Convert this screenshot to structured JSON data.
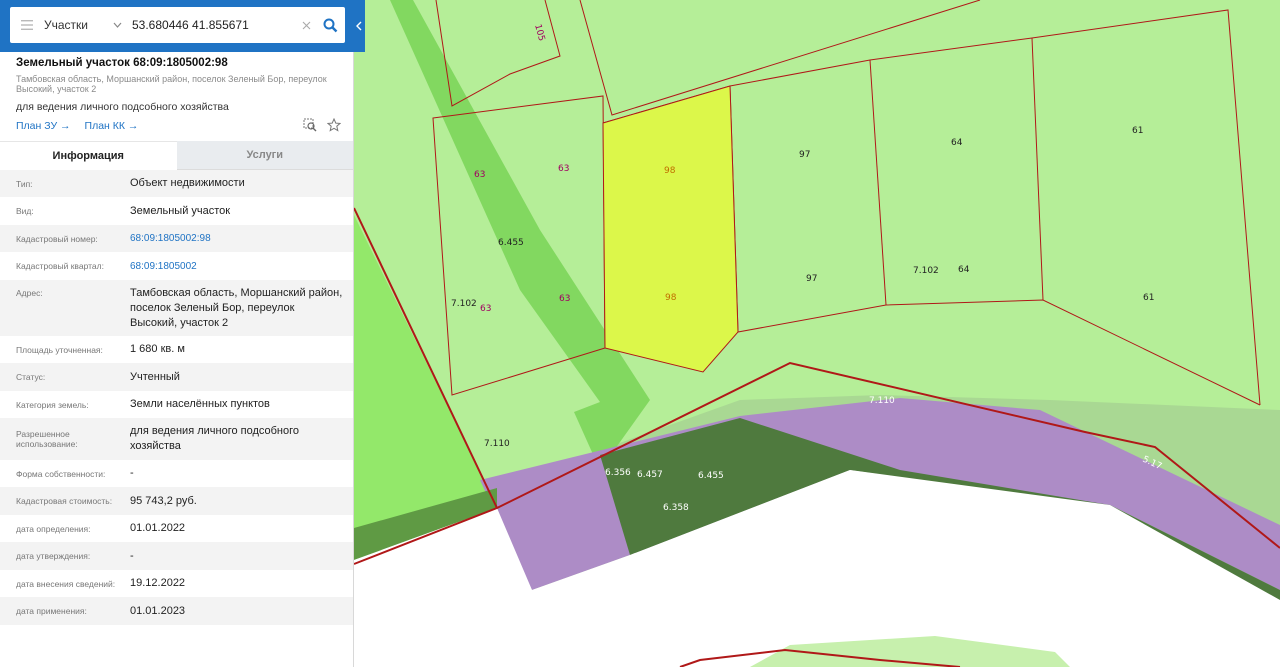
{
  "search": {
    "layer": "Участки",
    "query": "53.680446 41.855671"
  },
  "object": {
    "title": "Земельный участок 68:09:1805002:98",
    "address_short": "Тамбовская область, Моршанский район, поселок Зеленый Бор, переулок Высокий, участок 2",
    "purpose": "для ведения личного подсобного хозяйства",
    "link_plan_zu": "План ЗУ →",
    "link_plan_kk": "План КК →"
  },
  "tabs": {
    "info": "Информация",
    "services": "Услуги"
  },
  "details": [
    {
      "label": "Тип:",
      "value": "Объект недвижимости"
    },
    {
      "label": "Вид:",
      "value": "Земельный участок"
    },
    {
      "label": "Кадастровый номер:",
      "value": "68:09:1805002:98"
    },
    {
      "label": "Кадастровый квартал:",
      "value": "68:09:1805002"
    },
    {
      "label": "Адрес:",
      "value": "Тамбовская область, Моршанский район, поселок Зеленый Бор, переулок Высокий, участок 2"
    },
    {
      "label": "Площадь уточненная:",
      "value": "1 680 кв. м"
    },
    {
      "label": "Статус:",
      "value": "Учтенный"
    },
    {
      "label": "Категория земель:",
      "value": "Земли населённых пунктов"
    },
    {
      "label": "Разрешенное использование:",
      "value": "для ведения личного подсобного хозяйства"
    },
    {
      "label": "Форма собственности:",
      "value": "-"
    },
    {
      "label": "Кадастровая стоимость:",
      "value": "95 743,2 руб."
    },
    {
      "label": "дата определения:",
      "value": "01.01.2022"
    },
    {
      "label": "дата утверждения:",
      "value": "-"
    },
    {
      "label": "дата внесения сведений:",
      "value": "19.12.2022"
    },
    {
      "label": "дата применения:",
      "value": "01.01.2023"
    }
  ],
  "map_labels": {
    "l105": "105",
    "l63a": "63",
    "l63b": "63",
    "l63c": "63",
    "l63d": "63",
    "l98a": "98",
    "l98b": "98",
    "l97a": "97",
    "l97b": "97",
    "l64a": "64",
    "l64b": "64",
    "l61a": "61",
    "l61b": "61",
    "l6455a": "6.455",
    "l7102a": "7.102",
    "l7102b": "7.102",
    "l7110a": "7.110",
    "l7110b": "7.110",
    "l6356": "6.356",
    "l6457": "6.457",
    "l6455b": "6.455",
    "l6358": "6.358",
    "l517": "5.17"
  },
  "colors": {
    "accent": "#1f73c4",
    "parcel_fill": "#b5ee98",
    "selected_parcel": "#dcf74a",
    "boundary": "#b01818",
    "forest_dark": "#4f7a3e",
    "zone_purple": "#ad8cc6"
  },
  "icons": {
    "menu": "menu-icon",
    "search": "search-icon",
    "clear": "clear-icon",
    "collapse": "chevron-left-icon",
    "zoom_to": "zoom-to-object-icon",
    "favorite": "star-icon"
  }
}
